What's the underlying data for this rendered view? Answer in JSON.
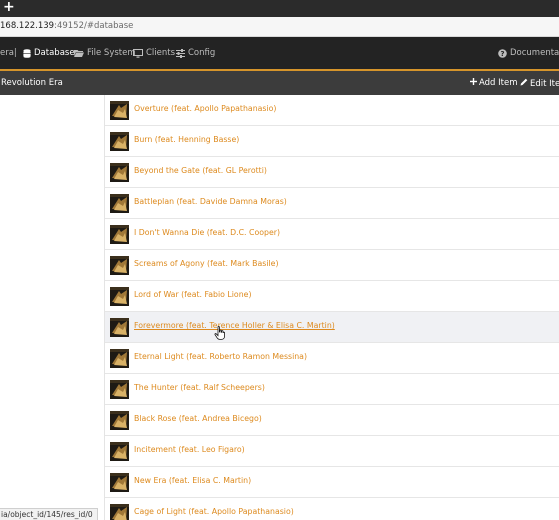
{
  "browser": {
    "new_tab_icon": "+",
    "url_host": "168.122.139",
    "url_rest": ":49152/#database"
  },
  "nav": {
    "cut_item": "era|",
    "database": "Database",
    "file_system": "File System",
    "clients": "Clients",
    "config": "Config",
    "documentation": "Documentatio"
  },
  "subbar": {
    "title": "Revolution Era",
    "add_item": "Add Item",
    "edit_item": "Edit Item"
  },
  "tracks": [
    {
      "label": "Overture (feat. Apollo Papathanasio)"
    },
    {
      "label": "Burn (feat. Henning Basse)"
    },
    {
      "label": "Beyond the Gate (feat. GL Perotti)"
    },
    {
      "label": "Battleplan (feat. Davide Damna Moras)"
    },
    {
      "label": "I Don't Wanna Die (feat. D.C. Cooper)"
    },
    {
      "label": "Screams of Agony (feat. Mark Basile)"
    },
    {
      "label": "Lord of War (feat. Fabio Lione)"
    },
    {
      "label": "Forevermore (feat. Terence Holler & Elisa C. Martin)"
    },
    {
      "label": "Eternal Light (feat. Roberto Ramon Messina)"
    },
    {
      "label": "The Hunter (feat. Ralf Scheepers)"
    },
    {
      "label": "Black Rose (feat. Andrea Bicego)"
    },
    {
      "label": "Incitement (feat. Leo Figaro)"
    },
    {
      "label": "New Era (feat. Elisa C. Martin)"
    },
    {
      "label": "Cage of Light (feat. Apollo Papathanasio)"
    }
  ],
  "status_url": "ia/object_id/145/res_id/0",
  "colors": {
    "accent": "#d6952b",
    "link": "#dd8a1e",
    "navbar": "#232323",
    "subbar": "#3c3c3c"
  }
}
